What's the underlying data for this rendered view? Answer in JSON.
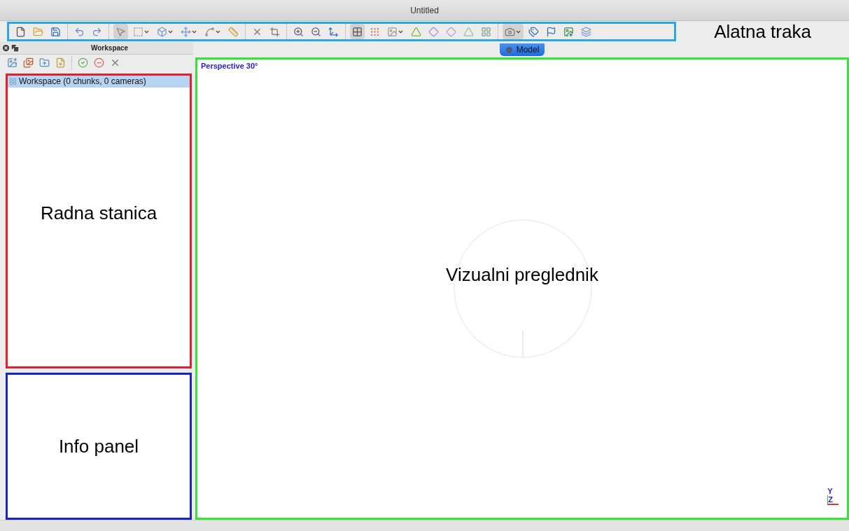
{
  "window": {
    "title": "Untitled"
  },
  "toolbar": {
    "groups": [
      [
        {
          "pressed": false
        },
        {
          "pressed": false
        },
        {
          "pressed": false
        }
      ],
      [
        {
          "pressed": false
        },
        {
          "pressed": false
        }
      ],
      [
        {
          "pressed": true
        },
        {
          "pressed": false
        },
        {
          "pressed": false
        },
        {
          "pressed": false
        },
        {
          "pressed": false
        },
        {
          "pressed": false
        }
      ],
      [
        {
          "pressed": false
        },
        {
          "pressed": false
        }
      ],
      [
        {
          "pressed": false
        },
        {
          "pressed": false
        },
        {
          "pressed": false
        }
      ],
      [
        {
          "pressed": true
        },
        {
          "pressed": false
        },
        {
          "pressed": false
        },
        {
          "pressed": false
        },
        {
          "pressed": false
        },
        {
          "pressed": false
        },
        {
          "pressed": false
        },
        {
          "pressed": false
        }
      ],
      [
        {
          "pressed": true
        },
        {
          "pressed": false
        },
        {
          "pressed": false
        },
        {
          "pressed": false
        },
        {
          "pressed": false
        }
      ]
    ]
  },
  "workspace": {
    "title": "Workspace",
    "tree": [
      {
        "label": "Workspace (0 chunks, 0 cameras)",
        "selected": true
      }
    ]
  },
  "viewer": {
    "tab": "Model",
    "projection": "Perspective 30°",
    "axes": [
      "Y",
      "Z"
    ]
  },
  "annotations": [
    {
      "kind": "toolbar",
      "label": "Alatna traka",
      "color": "#29a8e0"
    },
    {
      "kind": "workspace",
      "label": "Radna stanica",
      "color": "#e0202a"
    },
    {
      "kind": "info",
      "label": "Info panel",
      "color": "#1a22c8"
    },
    {
      "kind": "viewer",
      "label": "Vizualni preglednik",
      "color": "#33e633"
    }
  ]
}
